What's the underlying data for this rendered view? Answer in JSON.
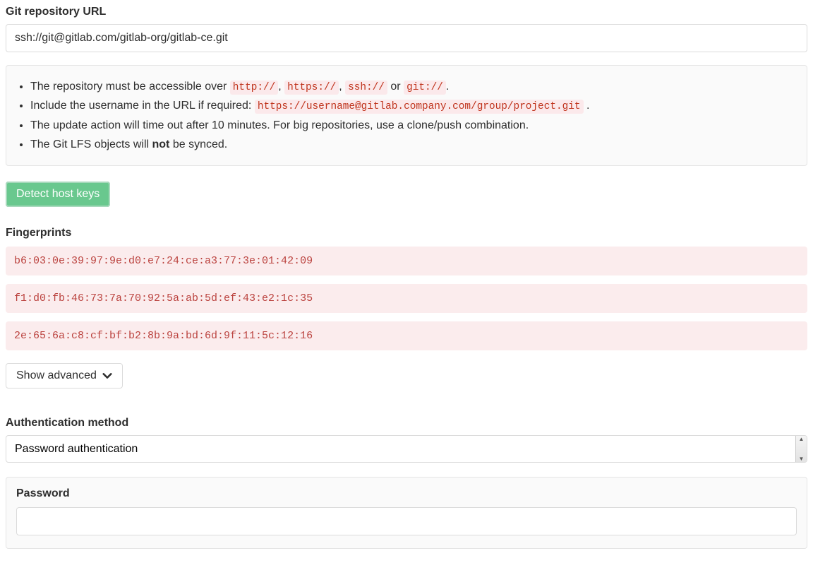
{
  "repo": {
    "label": "Git repository URL",
    "value": "ssh://git@gitlab.com/gitlab-org/gitlab-ce.git"
  },
  "help": {
    "item1_prefix": "The repository must be accessible over ",
    "p_http": "http://",
    "sep1": ", ",
    "p_https": "https://",
    "sep2": ", ",
    "p_ssh": "ssh://",
    "sep_or": " or ",
    "p_git": "git://",
    "period": ".",
    "item2_prefix": "Include the username in the URL if required: ",
    "example_url": "https://username@gitlab.company.com/group/project.git",
    "item2_suffix": " .",
    "item3": "The update action will time out after 10 minutes. For big repositories, use a clone/push combination.",
    "item4_prefix": "The Git LFS objects will ",
    "item4_strong": "not",
    "item4_suffix": " be synced."
  },
  "detect_button": "Detect host keys",
  "fingerprints": {
    "label": "Fingerprints",
    "fp0": "b6:03:0e:39:97:9e:d0:e7:24:ce:a3:77:3e:01:42:09",
    "fp1": "f1:d0:fb:46:73:7a:70:92:5a:ab:5d:ef:43:e2:1c:35",
    "fp2": "2e:65:6a:c8:cf:bf:b2:8b:9a:bd:6d:9f:11:5c:12:16"
  },
  "advanced_button": "Show advanced",
  "auth": {
    "label": "Authentication method",
    "selected": "Password authentication"
  },
  "password": {
    "label": "Password",
    "value": ""
  }
}
